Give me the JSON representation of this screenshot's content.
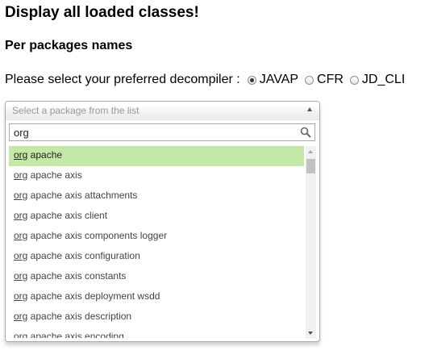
{
  "title": "Display all loaded classes!",
  "subtitle": "Per packages names",
  "decompiler": {
    "prompt": "Please select your preferred decompiler :",
    "options": [
      {
        "label": "JAVAP",
        "checked": true
      },
      {
        "label": "CFR",
        "checked": false
      },
      {
        "label": "JD_CLI",
        "checked": false
      }
    ]
  },
  "package_select": {
    "placeholder": "Select a package from the list",
    "search_value": "org",
    "highlight_color": "#c4e9a7",
    "results": [
      {
        "match": "org",
        "rest": " apache"
      },
      {
        "match": "org",
        "rest": " apache axis"
      },
      {
        "match": "org",
        "rest": " apache axis attachments"
      },
      {
        "match": "org",
        "rest": " apache axis client"
      },
      {
        "match": "org",
        "rest": " apache axis components logger"
      },
      {
        "match": "org",
        "rest": " apache axis configuration"
      },
      {
        "match": "org",
        "rest": " apache axis constants"
      },
      {
        "match": "org",
        "rest": " apache axis deployment wsdd"
      },
      {
        "match": "org",
        "rest": " apache axis description"
      },
      {
        "match": "org",
        "rest": " apache axis encoding"
      }
    ]
  }
}
